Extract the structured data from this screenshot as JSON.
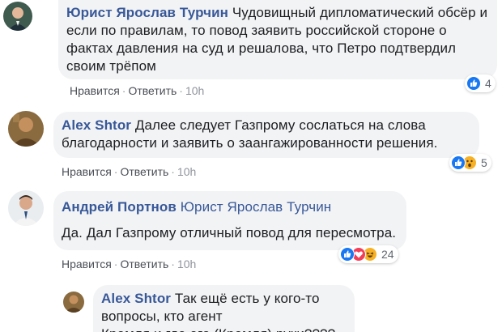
{
  "comments": [
    {
      "author": "Юрист Ярослав Турчин",
      "lines": [
        "Чудовищный дипломатический обсёр и",
        "если по правилам, то повод заявить российской стороне о",
        "фактах давления на суд и решалова, что Петро подтвердил",
        "своим трёпом"
      ],
      "like_label": "Нравится",
      "reply_label": "Ответить",
      "time": "10h",
      "reaction_count": "4",
      "reactions": [
        "like-icon"
      ]
    },
    {
      "author": "Alex Shtor",
      "lines": [
        "Далее следует Газпрому сослаться на слова",
        "благодарности и заявить о заангажированности решения."
      ],
      "like_label": "Нравится",
      "reply_label": "Ответить",
      "time": "10h",
      "reaction_count": "5",
      "reactions": [
        "like-icon",
        "wow-icon"
      ]
    },
    {
      "author": "Андрей Портнов",
      "mention": "Юрист Ярослав Турчин",
      "lines": [
        "Да. Дал Газпрому отличный повод для пересмотра."
      ],
      "like_label": "Нравится",
      "reply_label": "Ответить",
      "time": "10h",
      "reaction_count": "24",
      "reactions": [
        "like-icon",
        "love-icon",
        "haha-icon"
      ]
    },
    {
      "author": "Alex Shtor",
      "lines": [
        "Так ещё есть у кого-то вопросы, кто агент",
        "Кремля и где его (Кремля) руки????"
      ]
    }
  ],
  "colors": {
    "link": "#385898",
    "bubble": "#f2f3f5",
    "like": "#1877f2",
    "love": "#f33e58",
    "wow": "#f7b125"
  }
}
